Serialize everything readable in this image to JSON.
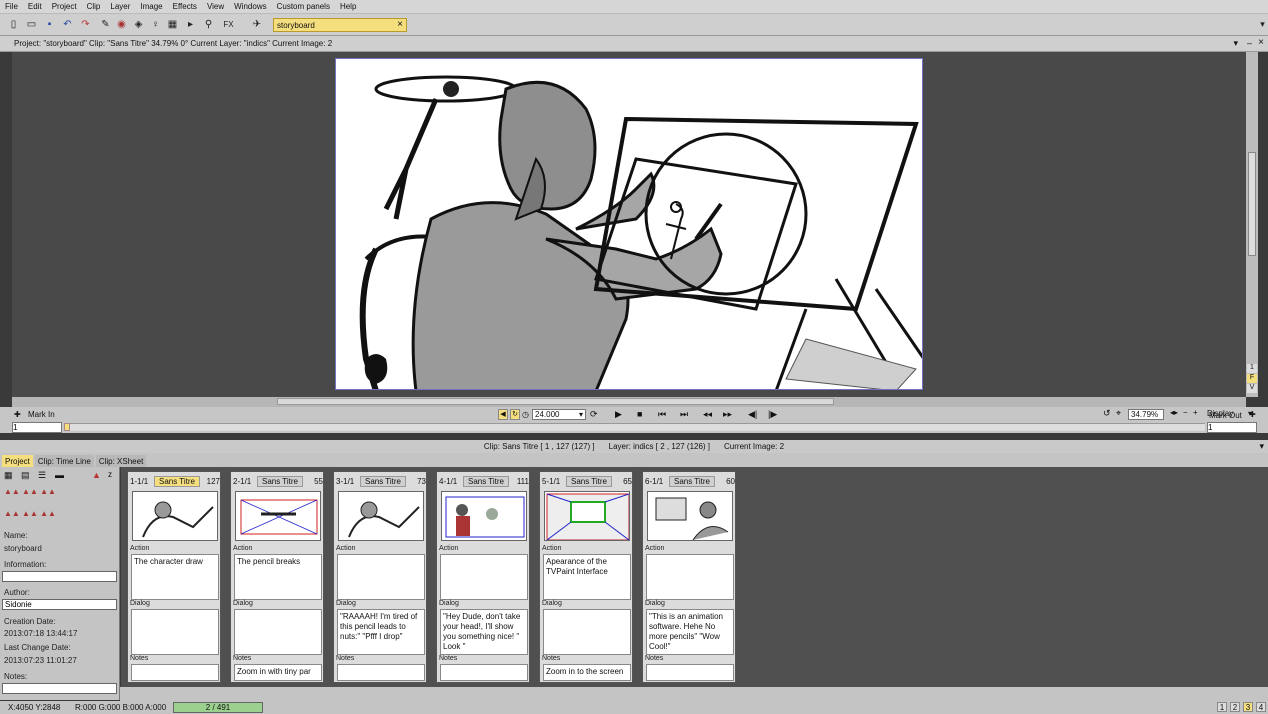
{
  "menu": [
    "File",
    "Edit",
    "Project",
    "Clip",
    "Layer",
    "Image",
    "Effects",
    "View",
    "Windows",
    "Custom panels",
    "Help"
  ],
  "project_tab": "storyboard",
  "infobar": "Project: \"storyboard\"  Clip: \"Sans Titre\"   34.79%   0°  Current Layer: \"indics\"   Current Image: 2",
  "playbar": {
    "mark_in_label": "Mark In",
    "mark_in_value": "1",
    "fps": "24.000",
    "zoom": "34.79%",
    "display": "Display",
    "mark_out_label": "Mark Out",
    "mark_out_value": "1"
  },
  "clipinfo": {
    "clip": "Clip: Sans Titre [ 1 , 127  (127) ]",
    "layer": "Layer: indics [ 2 , 127  (126) ]",
    "image": "Current Image: 2"
  },
  "tabs": [
    "Project",
    "Clip: Time Line",
    "Clip: XSheet"
  ],
  "side": {
    "name_label": "Name:",
    "name": "storyboard",
    "info_label": "Information:",
    "info": "",
    "author_label": "Author:",
    "author": "Sidonie",
    "creation_label": "Creation Date:",
    "creation": "2013:07:18 13:44:17",
    "change_label": "Last Change Date:",
    "change": "2013:07:23 11:01:27",
    "notes_label": "Notes:"
  },
  "field_labels": {
    "action": "Action",
    "dialog": "Dialog",
    "notes": "Notes"
  },
  "cards": [
    {
      "shot": "1-1/1",
      "name": "Sans Titre",
      "count": "127",
      "action": "The character draw",
      "dialog": "",
      "notes": ""
    },
    {
      "shot": "2-1/1",
      "name": "Sans Titre",
      "count": "55",
      "action": "The pencil breaks",
      "dialog": "",
      "notes": "Zoom in with tiny par"
    },
    {
      "shot": "3-1/1",
      "name": "Sans Titre",
      "count": "73",
      "action": "",
      "dialog": "\"RAAAAH! I'm tired of this pencil leads to nuts:\" \"Pfff I drop\"",
      "notes": ""
    },
    {
      "shot": "4-1/1",
      "name": "Sans Titre",
      "count": "111",
      "action": "",
      "dialog": "\"Hey Dude, don't take your head!, I'll show you something nice! \" Look \"",
      "notes": ""
    },
    {
      "shot": "5-1/1",
      "name": "Sans Titre",
      "count": "65",
      "action": "Apearance of the TVPaint Interface",
      "dialog": "",
      "notes": "Zoom in to the screen"
    },
    {
      "shot": "6-1/1",
      "name": "Sans Titre",
      "count": "60",
      "action": "",
      "dialog": "\"This is an animation software. Hehe No more pencils\" \"Wow Cool!\"",
      "notes": ""
    }
  ],
  "status": {
    "coords": "X:4050  Y:2848",
    "rgba": "R:000 G:000 B:000 A:000",
    "frame": "2 / 491",
    "pages": [
      "1",
      "2",
      "3",
      "4"
    ]
  }
}
